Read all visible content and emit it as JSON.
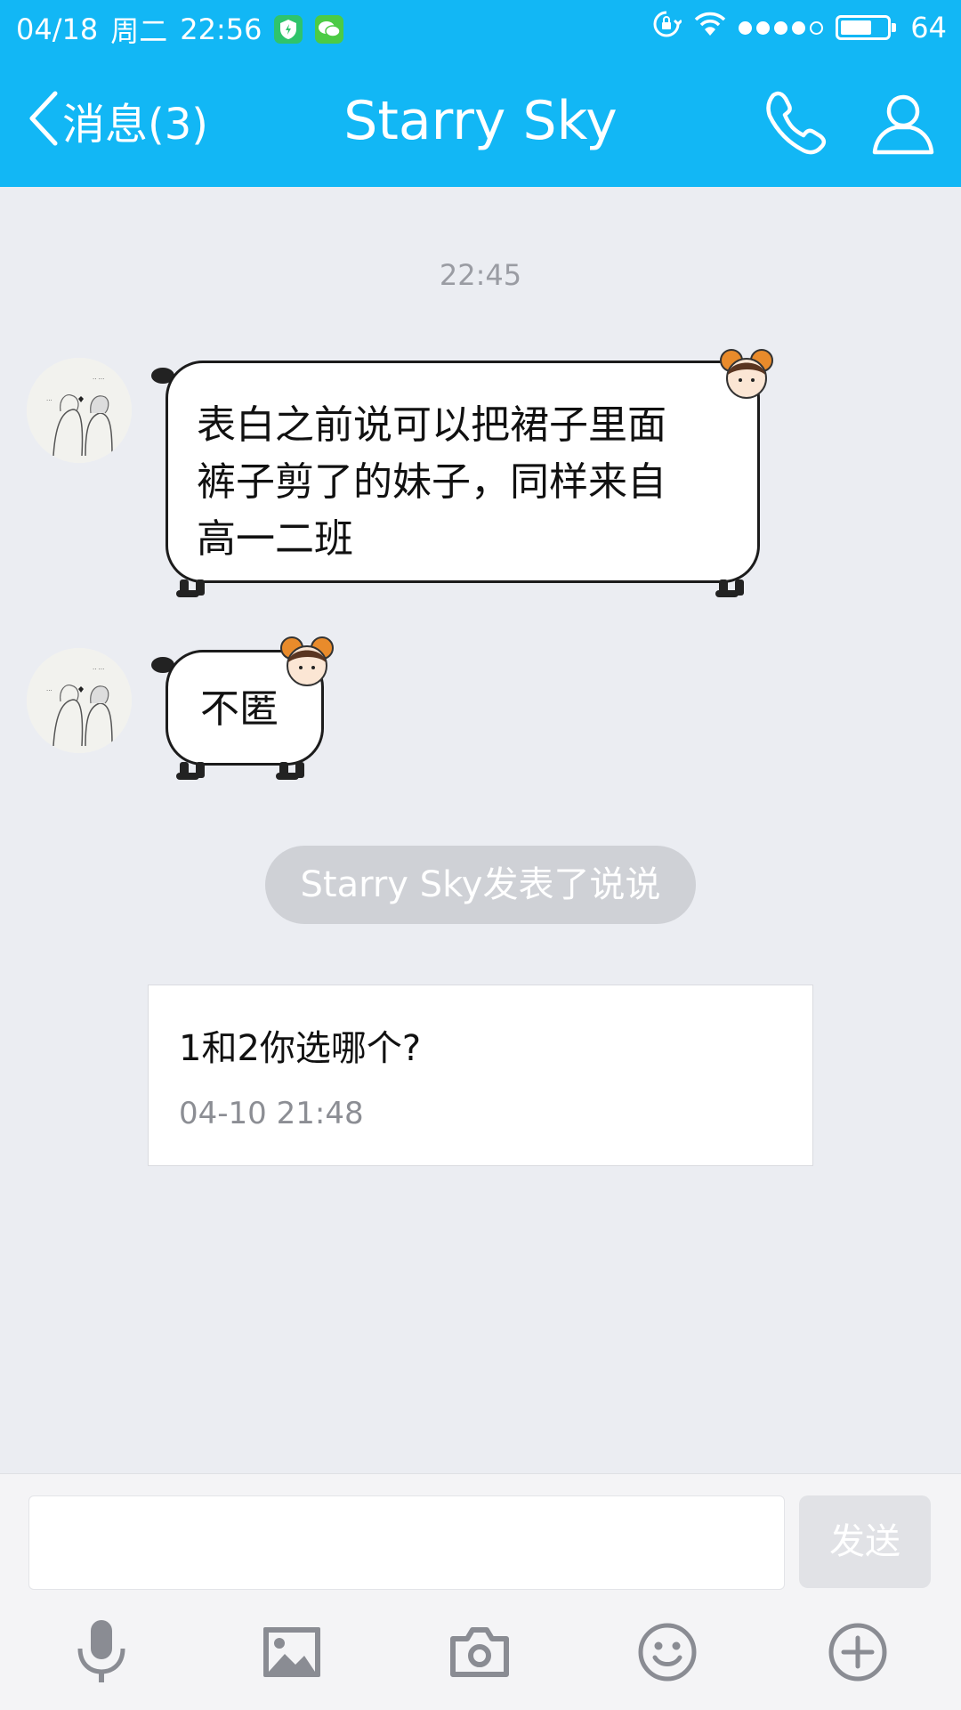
{
  "status_bar": {
    "date": "04/18",
    "weekday": "周二",
    "time": "22:56",
    "battery": "64",
    "battery_level_pct": 64,
    "signal_bars_filled": 4,
    "signal_bars_total": 5
  },
  "header": {
    "back_label": "消息(3)",
    "title": "Starry Sky",
    "accent_color": "#12b7f5"
  },
  "chat": {
    "timestamp": "22:45",
    "messages": [
      {
        "lines": [
          "表白之前说可以把裙子里面",
          "裤子剪了的妹子，同样来自",
          "高一二班"
        ]
      },
      {
        "lines": [
          "不匿"
        ]
      }
    ],
    "notice": "Starry Sky发表了说说",
    "card": {
      "title": "1和2你选哪个?",
      "time": "04-10 21:48"
    }
  },
  "input_bar": {
    "value": "",
    "send_label": "发送"
  },
  "toolbar_icons": [
    "microphone-icon",
    "image-icon",
    "camera-icon",
    "emoji-icon",
    "plus-icon"
  ]
}
